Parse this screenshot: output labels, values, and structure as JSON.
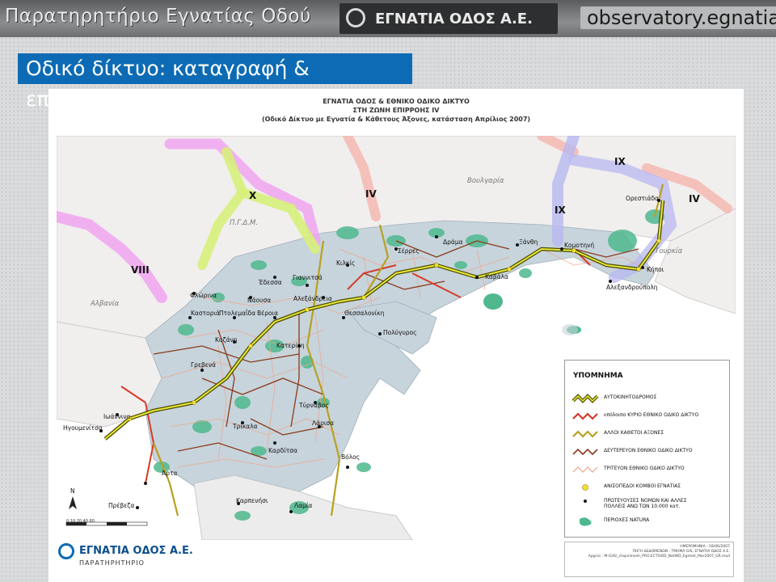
{
  "header": {
    "title": "Παρατηρητήριο Εγνατίας Οδού",
    "logo_text": "ΕΓΝΑΤΙΑ ΟΔΟΣ Α.Ε.",
    "url": "observatory.egnatia.gr"
  },
  "slide_title": "Οδικό δίκτυο: καταγραφή & επεξεργασία",
  "map": {
    "heading_1": "ΕΓΝΑΤΙΑ ΟΔΟΣ & ΕΘΝΙΚΟ ΟΔΙΚΟ ΔΙΚΤΥΟ",
    "heading_2": "ΣΤΗ ΖΩΝΗ ΕΠΙΡΡΟΗΣ IV",
    "heading_3": "(Οδικό Δίκτυο με Εγνατία & Κάθετους Άξονες, κατάσταση Απρίλιος 2007)",
    "corridors": [
      "X",
      "IV",
      "IX",
      "IX",
      "IV",
      "VIII"
    ],
    "countries": [
      "Βουλγαρία",
      "Π.Γ.Δ.Μ.",
      "Αλβανία",
      "Τουρκία"
    ],
    "cities": [
      "Ορεστιάδα",
      "Δράμα",
      "Ξάνθη",
      "Κομοτηνή",
      "Σέρρες",
      "Κιλκίς",
      "Κήποι",
      "Καβάλα",
      "Αλεξανδρούπολη",
      "Έδεσσα",
      "Γιαννιτσά",
      "Φλώρινα",
      "Νάουσα",
      "Αλεξάνδρεια",
      "Καστοριά",
      "Πτολεμαΐδα",
      "Βέροια",
      "Θεσσαλονίκη",
      "Πολύγυρος",
      "Κοζάνη",
      "Κατερίνη",
      "Γρεβενά",
      "Ιωάννινα",
      "Τύρναβος",
      "Ηγουμενίτσα",
      "Τρίκαλα",
      "Λάρισα",
      "Καρδίτσα",
      "Βόλος",
      "Άρτα",
      "Πρέβεζα",
      "Καρπενήσι",
      "Λαμία"
    ],
    "north": "N",
    "scale_ticks": "0  10  20      40       60"
  },
  "legend": {
    "title": "ΥΠΟΜΝΗΜΑ",
    "items": [
      "ΑΥΤΟΚΙΝΗΤΟΔΡΟΜΟΣ",
      "υπόλοιπο ΚΥΡΙΟ ΕΘΝΙΚΟ ΟΔΙΚΟ ΔΙΚΤΥΟ",
      "ΑΛΛΟΙ ΚΑΘΕΤΟΙ ΑΞΟΝΕΣ",
      "ΔΕΥΤΕΡΕΥΟΝ ΕΘΝΙΚΟ ΟΔΙΚΟ ΔΙΚΤΥΟ",
      "ΤΡΙΤΕΥΟΝ ΕΘΝΙΚΟ ΟΔΙΚΟ ΔΙΚΤΥΟ",
      "ΑΝΙΣΟΠΕΔΟΙ ΚΟΜΒΟΙ ΕΓΝΑΤΙΑΣ",
      "ΠΡΩΤΕΥΟΥΣΕΣ ΝΟΜΩΝ ΚΑΙ ΑΛΛΕΣ ΠΟΛΛΕΙΣ ΑΝΩ ΤΩΝ 10.000 κατ.",
      "ΠΕΡΙΟΧΕΣ NATURA"
    ],
    "colors": {
      "motorway": "#c9c92a",
      "main": "#d83a2a",
      "vertical": "#b8a020",
      "secondary": "#8b3a1a",
      "tertiary": "#f0a58a",
      "node": "#f2e03a",
      "natura": "#4fb88e"
    }
  },
  "info": {
    "line1": "ΗΜΕΡΟΜΗΝΙΑ : 18/06/2007",
    "line2": "ΠΗΓΗ ΔΕΔΟΜΕΝΩΝ : ΤΜΗΜΑ GIS, ΕΓΝΑΤΙΑ ΟΔΟΣ Α.Ε.",
    "line3": "Αρχείο : M:\\GIS\\_maps\\mesh_PRO.ECTS\\RD_NetWD_Egnhet_Mar2007_GR.mxd"
  },
  "bottom_logo": {
    "name": "ΕΓΝΑΤΙΑ ΟΔΟΣ Α.Ε.",
    "sub": "ΠΑΡΑΤΗΡΗΤΗΡΙΟ"
  }
}
